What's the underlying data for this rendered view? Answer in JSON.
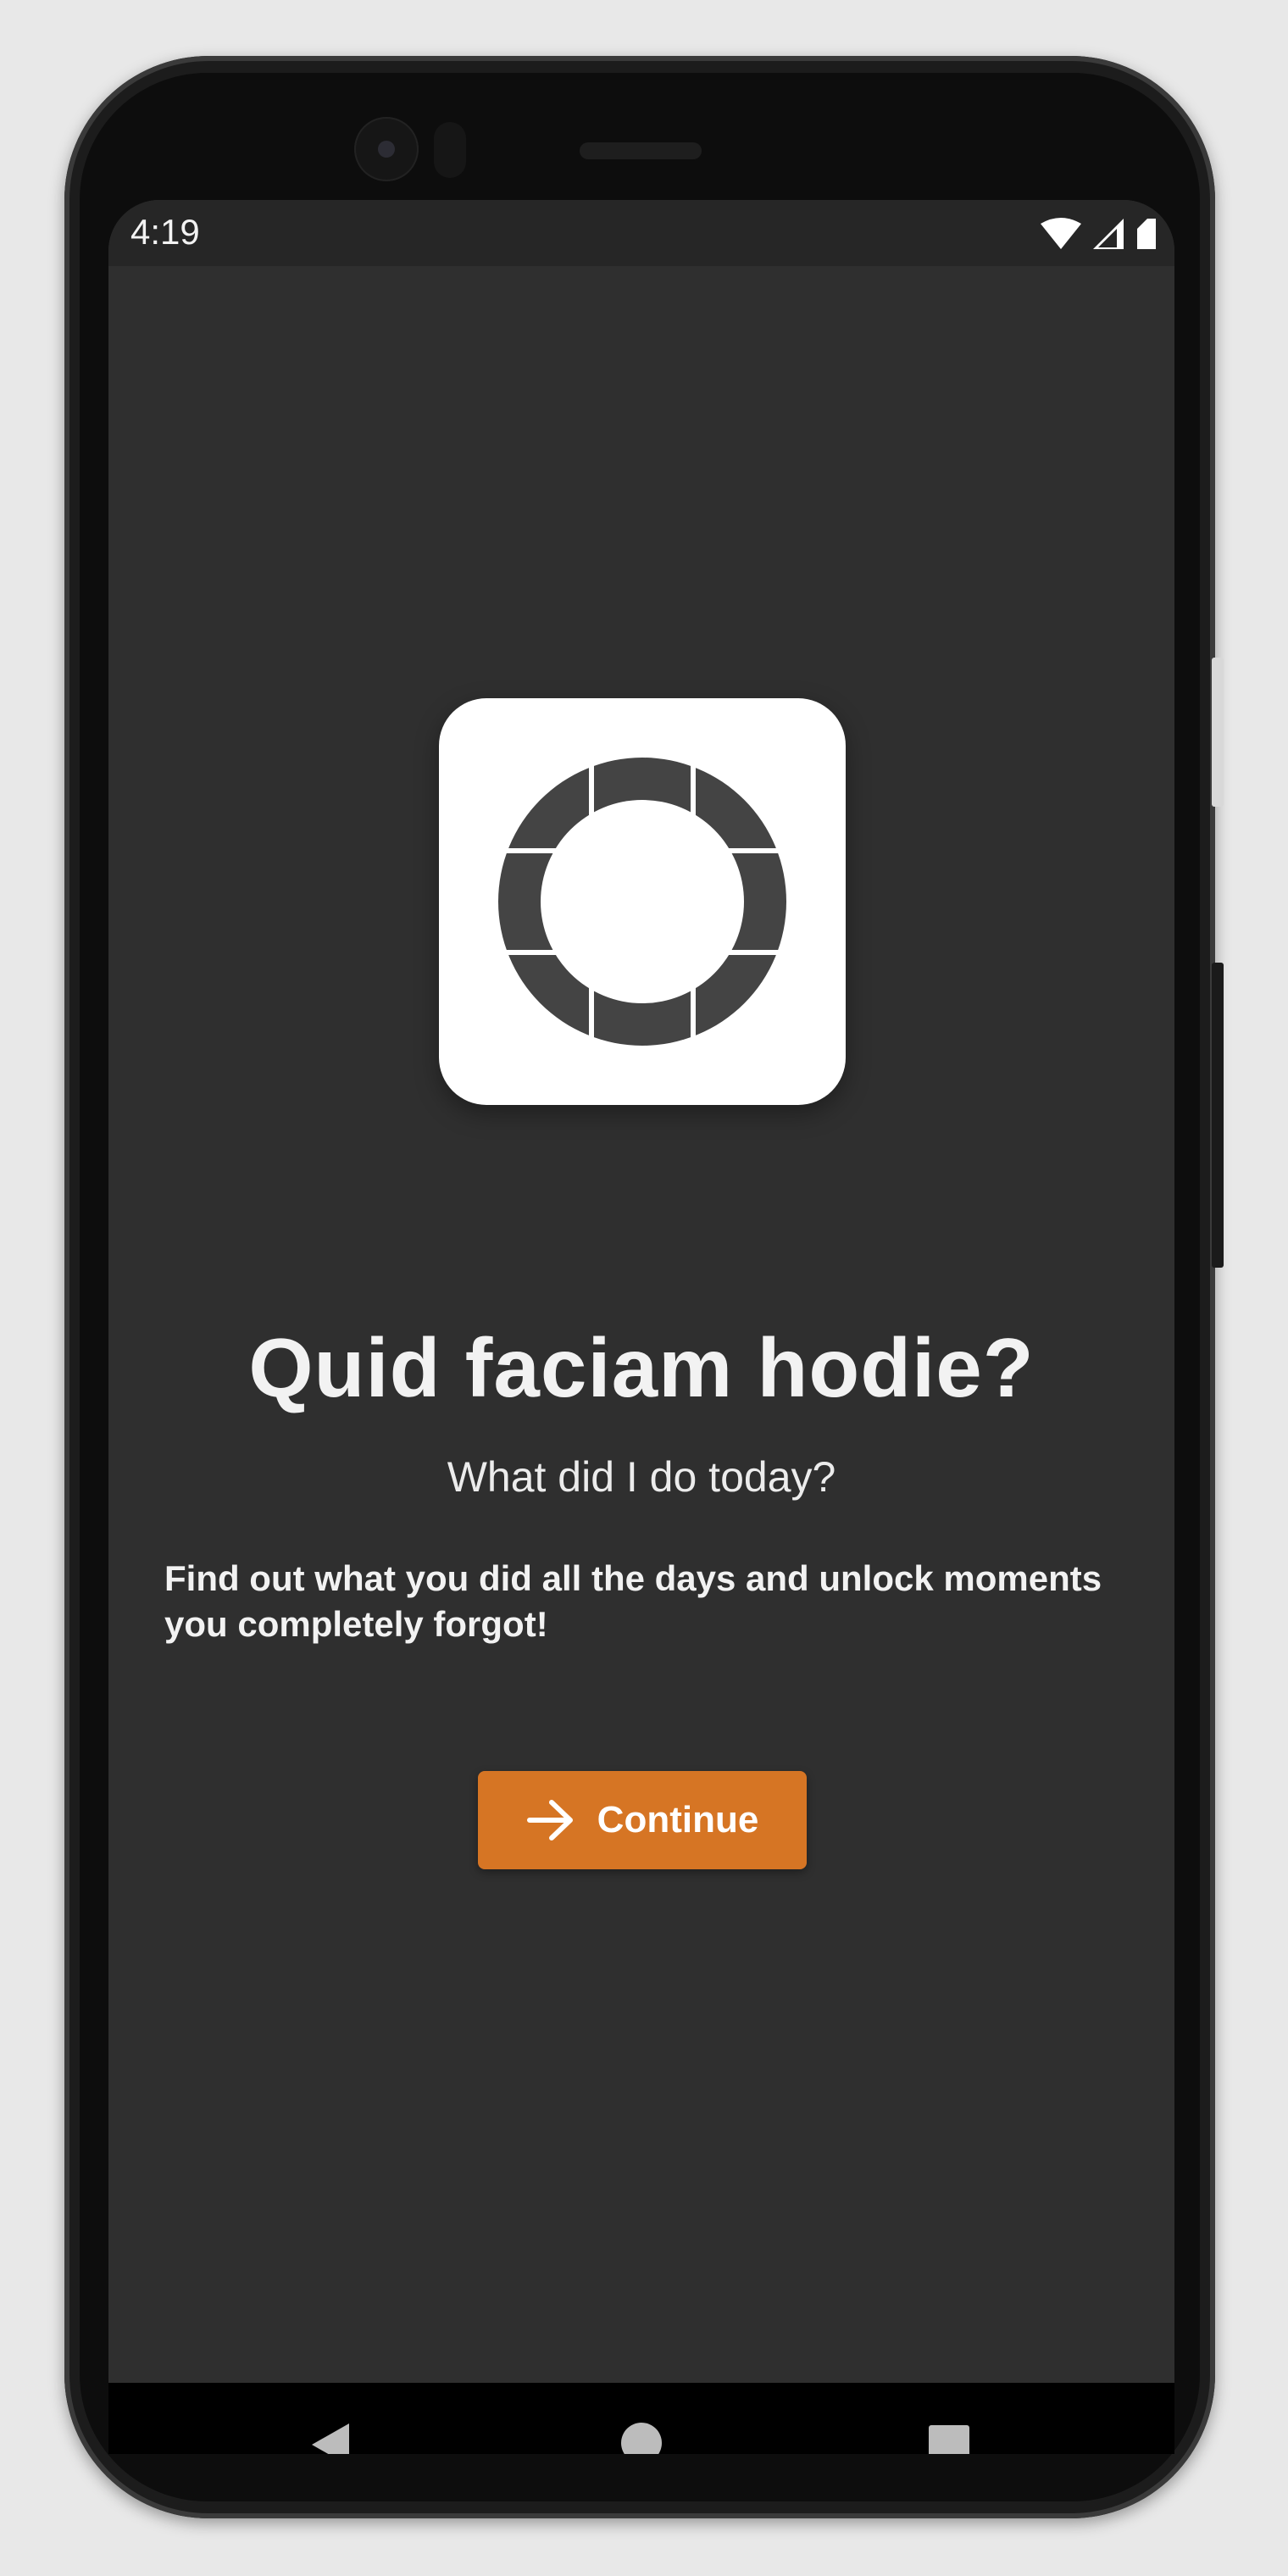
{
  "status_bar": {
    "time": "4:19",
    "icons": [
      "wifi-icon",
      "cellular-signal-icon",
      "battery-icon"
    ]
  },
  "app": {
    "title": "Quid faciam hodie?",
    "subtitle": "What did I do today?",
    "description": "Find out what you did all the days and unlock moments you completely forgot!",
    "continue_label": "Continue",
    "accent_color": "#d67524",
    "background_color": "#2f2f2f"
  },
  "nav_bar": {
    "buttons": [
      "back-icon",
      "home-icon",
      "recents-icon"
    ]
  }
}
